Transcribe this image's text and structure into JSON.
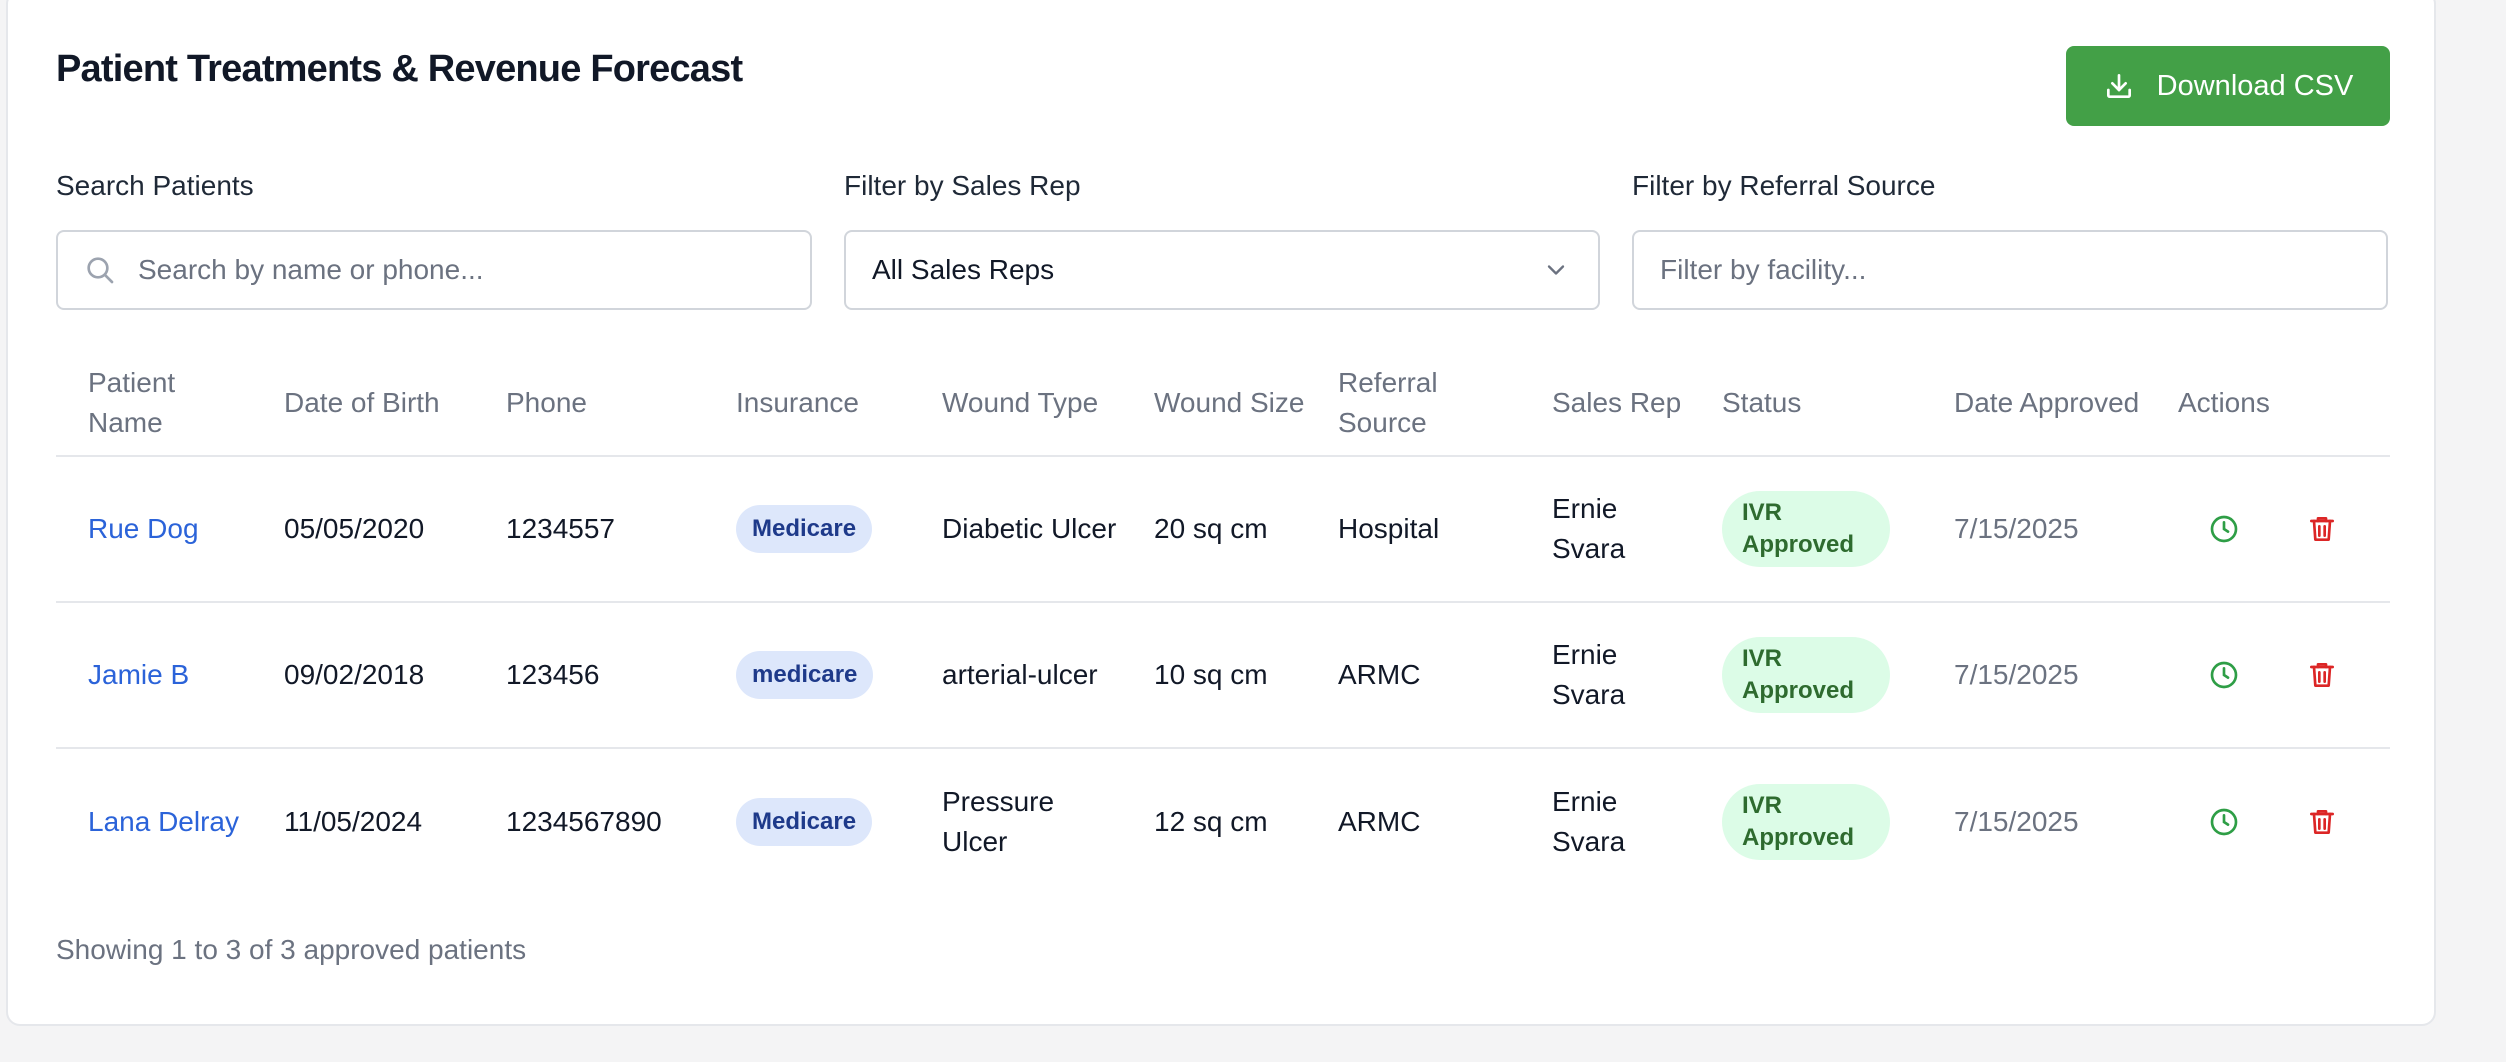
{
  "header": {
    "title": "Patient Treatments & Revenue Forecast",
    "download_label": "Download CSV",
    "download_icon": "download-icon"
  },
  "filters": {
    "search_label": "Search Patients",
    "search_placeholder": "Search by name or phone...",
    "sales_rep_label": "Filter by Sales Rep",
    "sales_rep_value": "All Sales Reps",
    "referral_label": "Filter by Referral Source",
    "referral_placeholder": "Filter by facility..."
  },
  "table": {
    "headers": {
      "patient": "Patient Name",
      "dob": "Date of Birth",
      "phone": "Phone",
      "insurance": "Insurance",
      "wound_type": "Wound Type",
      "wound_size": "Wound Size",
      "referral": "Referral Source",
      "sales_rep": "Sales Rep",
      "status": "Status",
      "date_approved": "Date Approved",
      "actions": "Actions"
    },
    "rows": [
      {
        "patient": "Rue Dog",
        "dob": "05/05/2020",
        "phone": "1234557",
        "insurance": "Medicare",
        "wound_type": "Diabetic Ulcer",
        "wound_size": "20 sq cm",
        "referral": "Hospital",
        "sales_rep": "Ernie Svara",
        "status": "IVR Approved",
        "date_approved": "7/15/2025"
      },
      {
        "patient": "Jamie B",
        "dob": "09/02/2018",
        "phone": "123456",
        "insurance": "medicare",
        "wound_type": "arterial-ulcer",
        "wound_size": "10 sq cm",
        "referral": "ARMC",
        "sales_rep": "Ernie Svara",
        "status": "IVR Approved",
        "date_approved": "7/15/2025"
      },
      {
        "patient": "Lana Delray",
        "dob": "11/05/2024",
        "phone": "1234567890",
        "insurance": "Medicare",
        "wound_type": "Pressure Ulcer",
        "wound_size": "12 sq cm",
        "referral": "ARMC",
        "sales_rep": "Ernie Svara",
        "status": "IVR Approved",
        "date_approved": "7/15/2025"
      }
    ]
  },
  "footer": {
    "summary": "Showing 1 to 3 of 3 approved patients"
  },
  "colors": {
    "accent_green": "#43a047",
    "link_blue": "#2b63d9",
    "delete_red": "#dc2626",
    "status_bg": "#dcfce7"
  }
}
